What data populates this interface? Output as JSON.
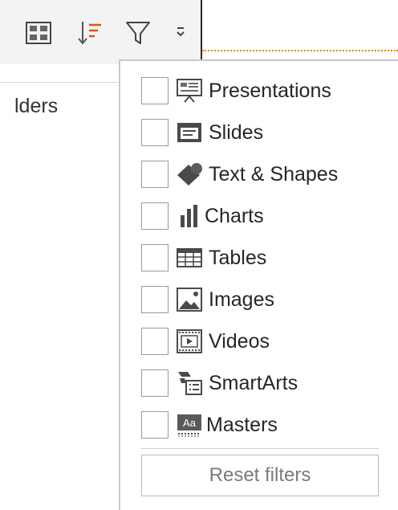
{
  "toolbar": {
    "icons": [
      "grid-view-icon",
      "sort-icon",
      "filter-icon",
      "more-options-icon"
    ],
    "accent_color": "#d9541e"
  },
  "left_pane": {
    "tab_label_partial": "lders"
  },
  "filter_menu": {
    "items": [
      {
        "label": "Presentations",
        "icon": "presentation-icon",
        "checked": false
      },
      {
        "label": "Slides",
        "icon": "slide-icon",
        "checked": false
      },
      {
        "label": "Text & Shapes",
        "icon": "shapes-icon",
        "checked": false
      },
      {
        "label": "Charts",
        "icon": "chart-icon",
        "checked": false
      },
      {
        "label": "Tables",
        "icon": "table-icon",
        "checked": false
      },
      {
        "label": "Images",
        "icon": "image-icon",
        "checked": false
      },
      {
        "label": "Videos",
        "icon": "video-icon",
        "checked": false
      },
      {
        "label": "SmartArts",
        "icon": "smartart-icon",
        "checked": false
      },
      {
        "label": "Masters",
        "icon": "master-icon",
        "checked": false
      }
    ],
    "reset_label": "Reset filters"
  }
}
